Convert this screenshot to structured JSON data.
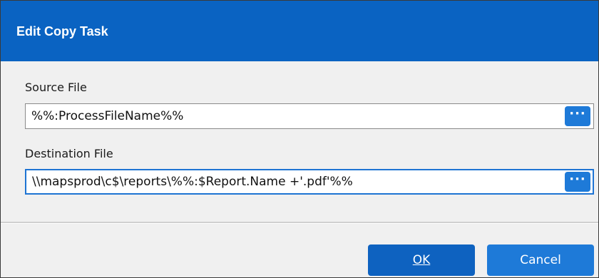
{
  "dialog": {
    "title": "Edit Copy Task"
  },
  "source": {
    "label": "Source File",
    "value": "%%:ProcessFileName%%",
    "browse_label": "···"
  },
  "destination": {
    "label": "Destination File",
    "value": "\\\\mapsprod\\c$\\reports\\%%:$Report.Name +'.pdf'%%",
    "browse_label": "···"
  },
  "buttons": {
    "ok_label": "OK",
    "cancel_label": "Cancel"
  },
  "colors": {
    "titlebar": "#0a63c2",
    "accent": "#1e7ad8",
    "ok_button": "#0e62c0",
    "dialog_bg": "#f0f0f0",
    "focus_border": "#1e74d3"
  }
}
